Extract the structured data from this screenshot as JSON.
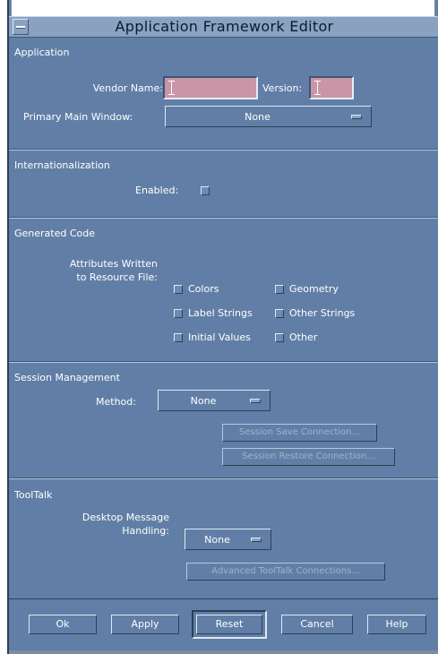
{
  "window": {
    "title": "Application Framework Editor"
  },
  "application": {
    "header": "Application",
    "vendor_label": "Vendor Name:",
    "vendor_value": "",
    "version_label": "Version:",
    "version_value": "",
    "primary_label": "Primary Main Window:",
    "primary_value": "None"
  },
  "i18n": {
    "header": "Internationalization",
    "enabled_label": "Enabled:"
  },
  "generated": {
    "header": "Generated Code",
    "attr_label_line1": "Attributes Written",
    "attr_label_line2": "to Resource File:",
    "checkboxes": [
      "Colors",
      "Geometry",
      "Label Strings",
      "Other Strings",
      "Initial Values",
      "Other"
    ]
  },
  "session": {
    "header": "Session Management",
    "method_label": "Method:",
    "method_value": "None",
    "save_btn": "Session Save Connection...",
    "restore_btn": "Session Restore Connection..."
  },
  "tooltalk": {
    "header": "ToolTalk",
    "handling_label_line1": "Desktop Message",
    "handling_label_line2": "Handling:",
    "handling_value": "None",
    "advanced_btn": "Advanced ToolTalk Connections..."
  },
  "footer": {
    "ok": "Ok",
    "apply": "Apply",
    "reset": "Reset",
    "cancel": "Cancel",
    "help": "Help"
  },
  "colors": {
    "panel": "#617fa6",
    "title": "#8aa2c2",
    "field": "#c996a8"
  }
}
